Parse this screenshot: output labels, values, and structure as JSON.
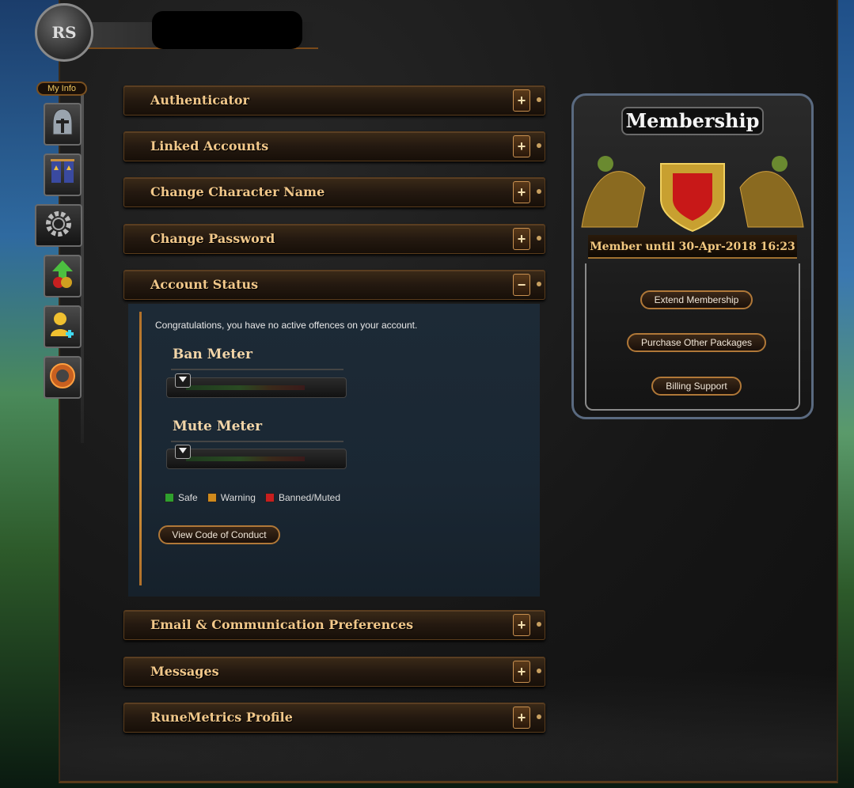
{
  "nav": {
    "my_info_label": "My Info",
    "items": [
      {
        "name": "helmet-icon"
      },
      {
        "name": "banner-icon"
      },
      {
        "name": "gear-icon"
      },
      {
        "name": "upgrade-arrow-icon"
      },
      {
        "name": "add-friend-icon"
      },
      {
        "name": "cog-orb-icon"
      }
    ]
  },
  "sections": {
    "authenticator": {
      "label": "Authenticator",
      "toggle": "+"
    },
    "linked_accounts": {
      "label": "Linked Accounts",
      "toggle": "+"
    },
    "change_character_name": {
      "label": "Change Character Name",
      "toggle": "+"
    },
    "change_password": {
      "label": "Change Password",
      "toggle": "+"
    },
    "account_status": {
      "label": "Account Status",
      "toggle": "−"
    },
    "email_prefs": {
      "label": "Email & Communication Preferences",
      "toggle": "+"
    },
    "messages": {
      "label": "Messages",
      "toggle": "+"
    },
    "runemetrics": {
      "label": "RuneMetrics Profile",
      "toggle": "+"
    }
  },
  "account_status": {
    "message": "Congratulations, you have no active offences on your account.",
    "ban_meter": {
      "title": "Ban Meter",
      "level": 0
    },
    "mute_meter": {
      "title": "Mute Meter",
      "level": 0
    },
    "legend": {
      "safe": "Safe",
      "warning": "Warning",
      "banned": "Banned/Muted"
    },
    "colors": {
      "safe": "#2ea02e",
      "warning": "#d08a1c",
      "banned": "#c81e1e"
    },
    "conduct_button": "View Code of Conduct"
  },
  "membership": {
    "title": "Membership",
    "status": "Member until 30-Apr-2018 16:23",
    "extend": "Extend Membership",
    "purchase": "Purchase Other Packages",
    "billing": "Billing Support"
  }
}
